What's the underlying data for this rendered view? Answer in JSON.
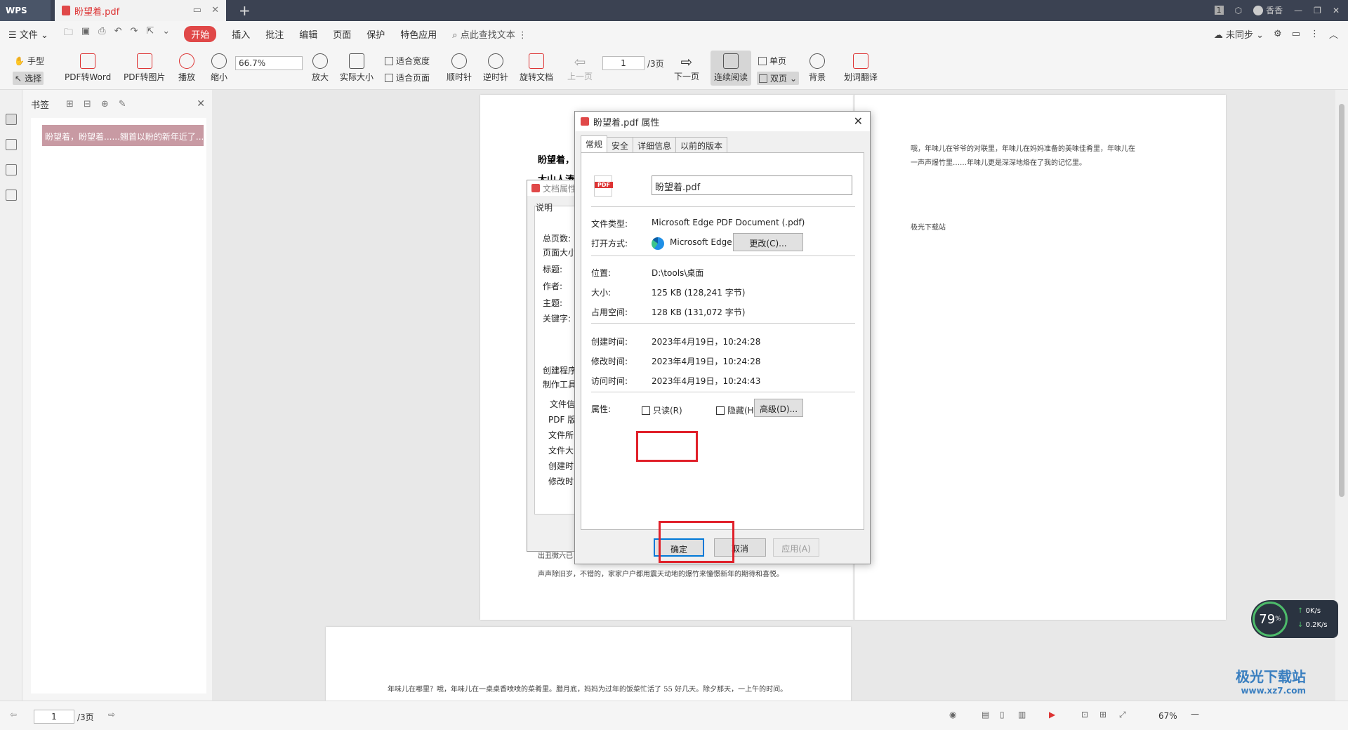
{
  "titlebar": {
    "app_tab": "WPS",
    "doc_tab": "盼望着.pdf",
    "new_tab": "+",
    "badge": "1",
    "user": "香香"
  },
  "menubar": {
    "file": "文件",
    "items": [
      "开始",
      "插入",
      "批注",
      "编辑",
      "页面",
      "保护",
      "特色应用"
    ],
    "search": "点此查找文本",
    "sync": "未同步"
  },
  "toolbar": {
    "hand": "手型",
    "select": "选择",
    "pdf_to_word": "PDF转Word",
    "pdf_to_image": "PDF转图片",
    "play": "播放",
    "zoom_out": "缩小",
    "zoom_value": "66.7%",
    "zoom_in": "放大",
    "actual_size": "实际大小",
    "fit_width": "适合宽度",
    "fit_page": "适合页面",
    "clockwise": "顺时针",
    "counterclockwise": "逆时针",
    "rotate_doc": "旋转文档",
    "prev_page": "上一页",
    "page_value": "1",
    "page_total": "/3页",
    "next_page": "下一页",
    "continuous": "连续阅读",
    "single": "单页",
    "double": "双页",
    "background": "背景",
    "translate": "划词翻译"
  },
  "bookmarks": {
    "title": "书签",
    "item": "盼望着，盼望着......翘首以盼的新年近了..."
  },
  "doc": {
    "left_title_1": "盼望着，",
    "left_title_2": "大山人涛",
    "left_bottom_1": "出丑微六已",
    "left_bottom_2": "声声除旧岁，不错的，家家户户都用震天动地的爆竹来憧憬新年的期待和喜悦。",
    "right_p1": "哦，年味儿在爷爷的对联里，年味儿在妈妈准备的美味佳肴里，年味儿在",
    "right_p2": "一声声爆竹里……年味儿更是深深地烙在了我的记忆里。",
    "right_p3": "极光下载站",
    "page2_p1": "年味儿在哪里？哦，年味儿在一桌桌香喷喷的菜肴里。腊月底，妈妈为过年的饭菜忙活了 55 好几天。除夕那天，一上午的时间。"
  },
  "docprops_dialog": {
    "title": "文档属性",
    "tab": "说明",
    "labels": [
      "总页数:",
      "页面大小",
      "标题:",
      "作者:",
      "主题:",
      "关键字:",
      "创建程序",
      "制作工具",
      "文件信息",
      "PDF 版",
      "文件所",
      "文件大",
      "创建时",
      "修改时"
    ]
  },
  "dialog": {
    "title": "盼望着.pdf 属性",
    "tabs": [
      "常规",
      "安全",
      "详细信息",
      "以前的版本"
    ],
    "pdf_badge": "PDF",
    "filename": "盼望着.pdf",
    "type_label": "文件类型:",
    "type_value": "Microsoft Edge PDF Document (.pdf)",
    "open_label": "打开方式:",
    "open_value": "Microsoft Edge",
    "change_btn": "更改(C)...",
    "location_label": "位置:",
    "location_value": "D:\\tools\\桌面",
    "size_label": "大小:",
    "size_value": "125 KB (128,241 字节)",
    "disk_label": "占用空间:",
    "disk_value": "128 KB (131,072 字节)",
    "created_label": "创建时间:",
    "created_value": "2023年4月19日，10:24:28",
    "modified_label": "修改时间:",
    "modified_value": "2023年4月19日，10:24:28",
    "accessed_label": "访问时间:",
    "accessed_value": "2023年4月19日，10:24:43",
    "attr_label": "属性:",
    "readonly": "只读(R)",
    "hidden": "隐藏(H)",
    "advanced_btn": "高级(D)...",
    "ok_btn": "确定",
    "cancel_btn": "取消",
    "apply_btn": "应用(A)"
  },
  "statusbar": {
    "page_value": "1",
    "page_total": "/3页",
    "zoom": "67%"
  },
  "speed_widget": {
    "percent": "79",
    "unit": "%",
    "up": "0",
    "down": "0.2",
    "rate_unit": "K/s"
  },
  "watermark": {
    "name": "极光下载站",
    "url": "www.xz7.com"
  }
}
